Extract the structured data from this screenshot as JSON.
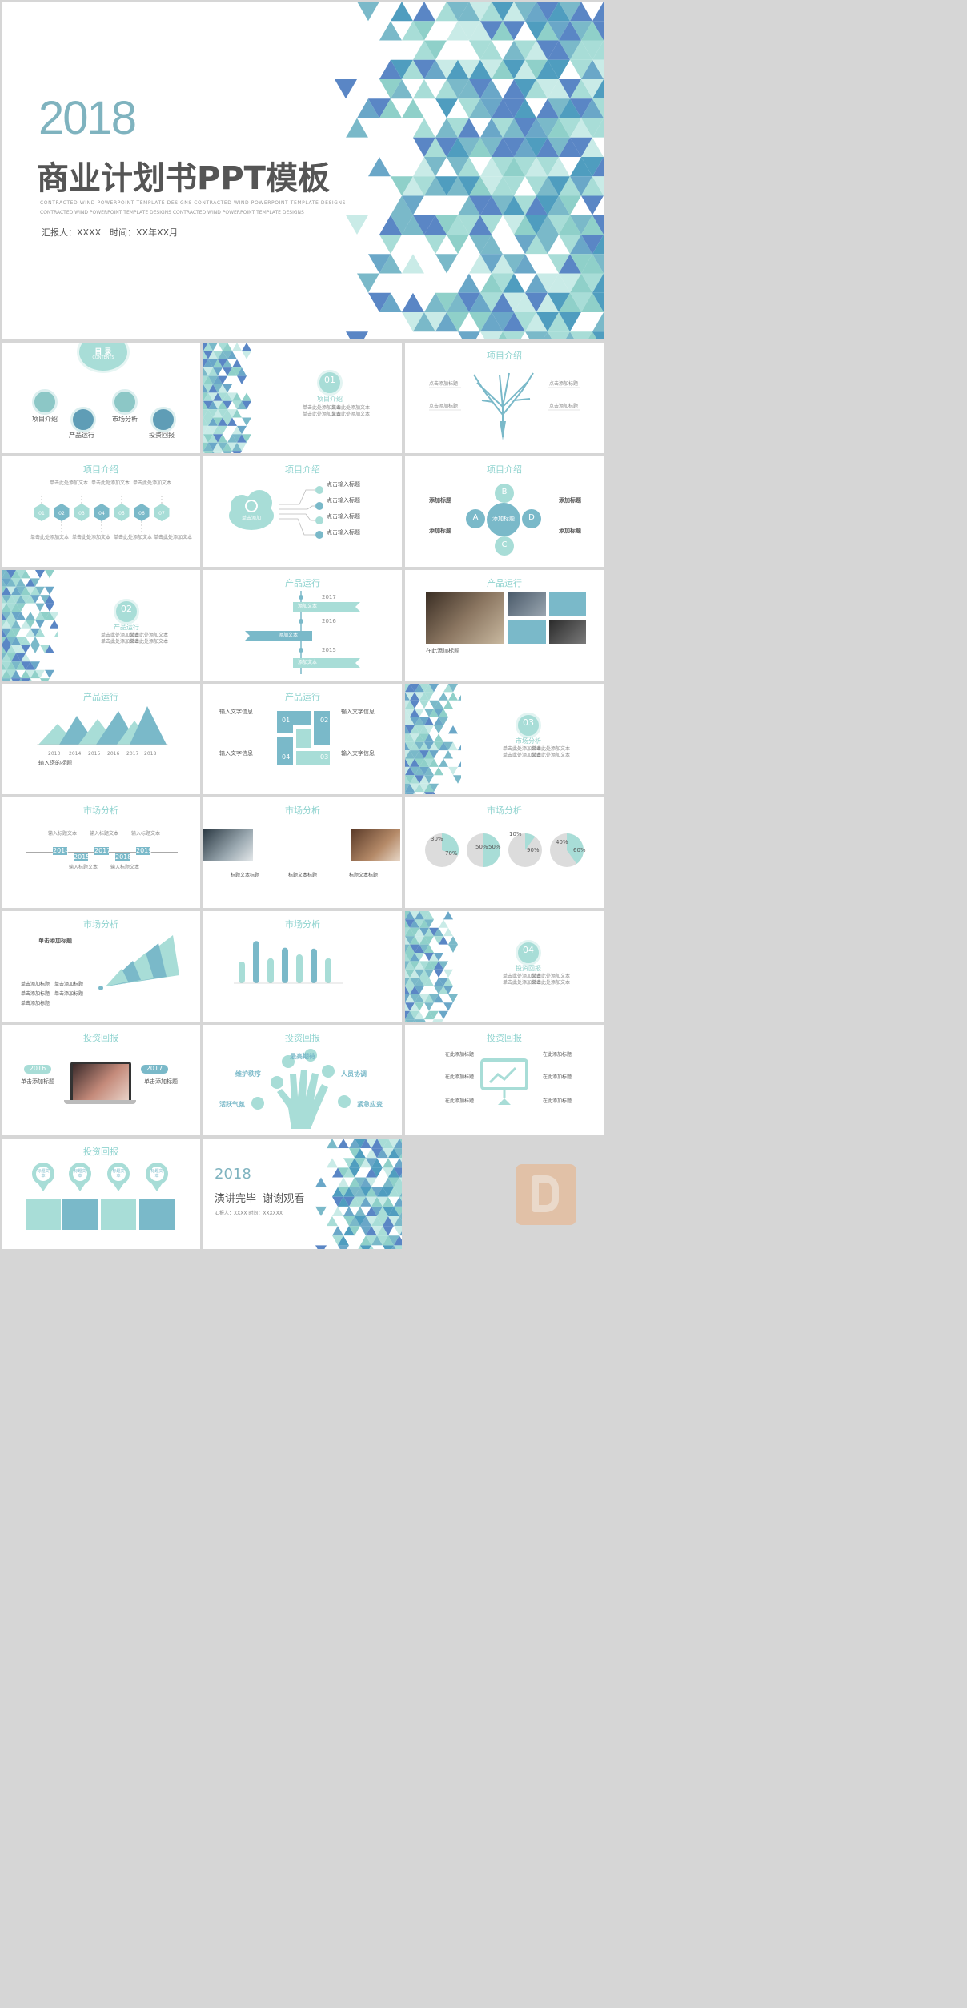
{
  "cover": {
    "year": "2018",
    "title": "商业计划书PPT模板",
    "subtitle_line1": "CONTRACTED WIND POWERPOINT TEMPLATE DESIGNS CONTRACTED WIND POWERPOINT TEMPLATE DESIGNS",
    "subtitle_line2": "CONTRACTED WIND POWERPOINT TEMPLATE DESIGNS CONTRACTED WIND POWERPOINT TEMPLATE DESIGNS",
    "reporter": "汇报人：XXXX",
    "time": "时间：XX年XX月"
  },
  "toc": {
    "badge": "目 录",
    "badge_sub": "CONTENTS",
    "items": [
      "项目介绍",
      "产品运行",
      "市场分析",
      "投资回报"
    ]
  },
  "section1": {
    "num": "01",
    "title": "项目介绍",
    "lines": [
      "单击此处添加文本",
      "单击此处添加文本",
      "单击此处添加文本",
      "单击此处添加文本"
    ]
  },
  "slide_tree": {
    "title": "项目介绍",
    "labels": [
      "点击添加标题",
      "点击添加标题",
      "点击添加标题",
      "点击添加标题"
    ]
  },
  "slide_hex": {
    "title": "项目介绍",
    "nodes": [
      "01",
      "02",
      "03",
      "04",
      "05",
      "06",
      "07"
    ],
    "text": "单击此处添加文本"
  },
  "slide_cloud": {
    "title": "项目介绍",
    "nums": [
      "01",
      "02",
      "03",
      "04"
    ],
    "heads": [
      "点击输入标题",
      "点击输入标题",
      "点击输入标题",
      "点击输入标题"
    ],
    "cloud_label": "单击添加"
  },
  "slide_abcd": {
    "title": "项目介绍",
    "center": "添加标题",
    "letters": [
      "A",
      "B",
      "C",
      "D"
    ],
    "heads": [
      "添加标题",
      "添加标题",
      "添加标题",
      "添加标题"
    ]
  },
  "section2": {
    "num": "02",
    "title": "产品运行",
    "lines": [
      "单击此处添加文本",
      "单击此处添加文本",
      "单击此处添加文本",
      "单击此处添加文本"
    ]
  },
  "slide_timeline": {
    "title": "产品运行",
    "years": [
      "2017",
      "2016",
      "2015"
    ],
    "labels": [
      "添加文本",
      "添加文本",
      "添加文本"
    ]
  },
  "slide_photos": {
    "title": "产品运行",
    "caption": "在此添加标题"
  },
  "slide_mountains": {
    "title": "产品运行",
    "years": [
      "2013",
      "2014",
      "2015",
      "2016",
      "2017",
      "2018"
    ],
    "caption": "输入您的标题"
  },
  "slide_puzzle": {
    "title": "产品运行",
    "nums": [
      "01",
      "02",
      "04",
      "03"
    ],
    "heads": [
      "输入文字信息",
      "输入文字信息",
      "输入文字信息",
      "输入文字信息"
    ]
  },
  "section3": {
    "num": "03",
    "title": "市场分析",
    "lines": [
      "单击此处添加文本",
      "单击此处添加文本",
      "单击此处添加文本",
      "单击此处添加文本"
    ]
  },
  "slide_years_line": {
    "title": "市场分析",
    "years": [
      "2014",
      "2015",
      "2017",
      "2018",
      "2019"
    ],
    "label": "输入标题文本"
  },
  "slide_pics3": {
    "title": "市场分析",
    "heads": [
      "标题文本标题",
      "标题文本标题",
      "标题文本标题"
    ]
  },
  "slide_pies": {
    "title": "市场分析",
    "pies": [
      {
        "a": "30%",
        "b": "70%",
        "frac": 0.3
      },
      {
        "a": "50%",
        "b": "50%",
        "frac": 0.5
      },
      {
        "a": "10%",
        "b": "90%",
        "frac": 0.1
      },
      {
        "a": "40%",
        "b": "60%",
        "frac": 0.4
      }
    ]
  },
  "slide_fan": {
    "title": "市场分析",
    "head": "单击添加标题",
    "items": [
      "单击添加标题",
      "单击添加标题",
      "单击添加标题",
      "单击添加标题",
      "单击添加标题"
    ]
  },
  "slide_bars": {
    "title": "市场分析",
    "values": [
      45,
      88,
      52,
      74,
      60,
      72,
      52
    ]
  },
  "section4": {
    "num": "04",
    "title": "投资回报",
    "lines": [
      "单击此处添加文本",
      "单击此处添加文本",
      "单击此处添加文本",
      "单击此处添加文本"
    ]
  },
  "slide_laptop": {
    "title": "投资回报",
    "left_year": "2016",
    "right_year": "2017",
    "left_head": "单击添加标题",
    "right_head": "单击添加标题"
  },
  "slide_hand": {
    "title": "投资回报",
    "labels": [
      "最高期待",
      "维护秩序",
      "人员协调",
      "活跃气氛",
      "紧急应变"
    ]
  },
  "slide_board": {
    "title": "投资回报",
    "heads": [
      "在此添加标题",
      "在此添加标题",
      "在此添加标题",
      "在此添加标题",
      "在此添加标题",
      "在此添加标题"
    ]
  },
  "slide_pins": {
    "title": "投资回报",
    "pins": [
      "标题文本",
      "标题文本",
      "标题文本",
      "标题文本"
    ]
  },
  "closing": {
    "year": "2018",
    "text": "演讲完毕  谢谢观看",
    "reporter": "汇报人：XXXX  时间：XXXXXX"
  },
  "colors": {
    "teal": "#7ab9c9",
    "mint": "#a8ddd7",
    "blue": "#5a86c5",
    "title_gray": "#555555"
  }
}
